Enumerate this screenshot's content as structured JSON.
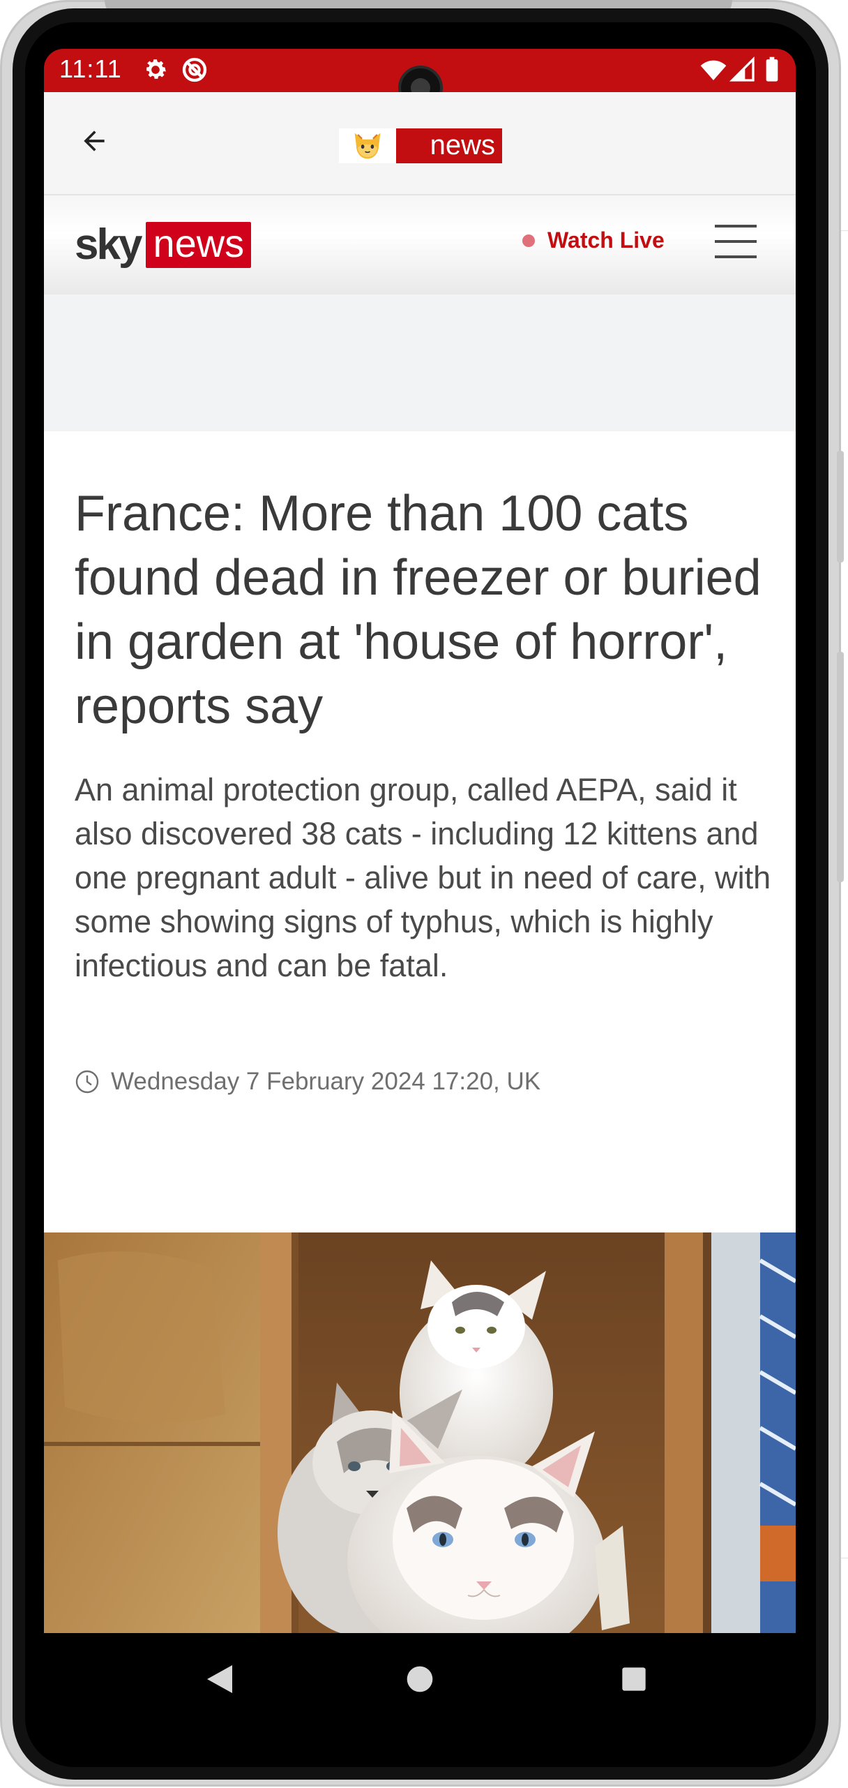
{
  "status_bar": {
    "time": "11:11",
    "left_icons": [
      "settings-icon",
      "do-not-disturb-icon"
    ],
    "right_icons": [
      "wifi-icon",
      "signal-icon",
      "battery-icon"
    ],
    "color": "#c20e11"
  },
  "app_bar": {
    "back_icon": "arrow-left-icon",
    "logo_emoji": "🐱",
    "logo_text": "news"
  },
  "site_header": {
    "brand_sky": "sky",
    "brand_news": "news",
    "watch_live_label": "Watch Live",
    "menu_icon": "hamburger-menu-icon"
  },
  "article": {
    "headline": "France: More than 100 cats found dead in freezer or buried in garden at 'house of horror', reports say",
    "standfirst": "An animal protection group, called AEPA, said it also discovered 38 cats - including 12 kittens and one pregnant adult - alive but in need of care, with some showing signs of typhus, which is highly infectious and can be fatal.",
    "date": "Wednesday 7 February 2024 17:20, UK",
    "image_subject": "three-cats-in-wooden-shelter"
  },
  "nav_bar": {
    "buttons": [
      "back-triangle-icon",
      "home-circle-icon",
      "recents-square-icon"
    ]
  },
  "colors": {
    "brand_red": "#c20e11",
    "sky_red": "#d0021b",
    "headline_text": "#3a3a3a"
  }
}
